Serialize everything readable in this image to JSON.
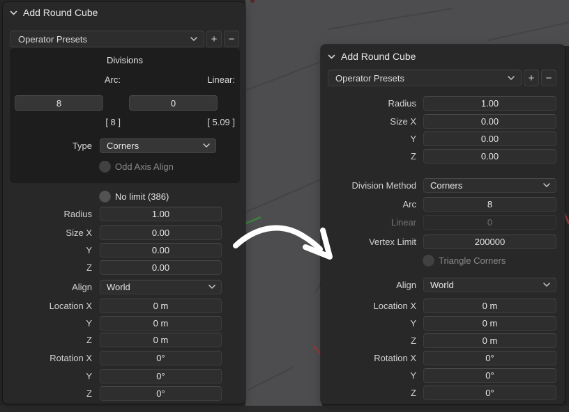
{
  "colors": {
    "panel_bg": "#282828",
    "subpanel_bg": "#1d1d1d",
    "viewport_gray": "#4d4d4f",
    "field_bg": "#2e2e2e",
    "text": "#dedede",
    "disabled_text": "#757575",
    "arrow": "#ffffff",
    "axis_green": "#3f7d3f",
    "axis_red": "#8a3c3c"
  },
  "left_panel": {
    "title": "Add Round Cube",
    "presets": {
      "label": "Operator Presets",
      "add": "+",
      "remove": "−"
    },
    "divisions": {
      "title": "Divisions",
      "arc_label": "Arc:",
      "linear_label": "Linear:",
      "arc_value": "8",
      "linear_value": "0",
      "arc_hint": "[ 8 ]",
      "linear_hint": "[ 5.09 ]",
      "type": {
        "label": "Type",
        "value": "Corners"
      },
      "odd_axis_label": "Odd Axis Align"
    },
    "no_limit_label": "No limit (386)",
    "fields": [
      {
        "label": "Radius",
        "value": "1.00"
      },
      {
        "label": "Size X",
        "value": "0.00"
      },
      {
        "label": "Y",
        "value": "0.00"
      },
      {
        "label": "Z",
        "value": "0.00"
      }
    ],
    "align": {
      "label": "Align",
      "value": "World"
    },
    "location": [
      {
        "label": "Location X",
        "value": "0 m"
      },
      {
        "label": "Y",
        "value": "0 m"
      },
      {
        "label": "Z",
        "value": "0 m"
      }
    ],
    "rotation": [
      {
        "label": "Rotation X",
        "value": "0°"
      },
      {
        "label": "Y",
        "value": "0°"
      },
      {
        "label": "Z",
        "value": "0°"
      }
    ]
  },
  "right_panel": {
    "title": "Add Round Cube",
    "presets": {
      "label": "Operator Presets",
      "add": "+",
      "remove": "−"
    },
    "fields": [
      {
        "label": "Radius",
        "value": "1.00"
      },
      {
        "label": "Size X",
        "value": "0.00"
      },
      {
        "label": "Y",
        "value": "0.00"
      },
      {
        "label": "Z",
        "value": "0.00"
      }
    ],
    "division_method": {
      "label": "Division Method",
      "value": "Corners"
    },
    "arc": {
      "label": "Arc",
      "value": "8"
    },
    "linear": {
      "label": "Linear",
      "value": "0"
    },
    "vertex_limit": {
      "label": "Vertex Limit",
      "value": "200000"
    },
    "triangle_corners_label": "Triangle Corners",
    "align": {
      "label": "Align",
      "value": "World"
    },
    "location": [
      {
        "label": "Location X",
        "value": "0 m"
      },
      {
        "label": "Y",
        "value": "0 m"
      },
      {
        "label": "Z",
        "value": "0 m"
      }
    ],
    "rotation": [
      {
        "label": "Rotation X",
        "value": "0°"
      },
      {
        "label": "Y",
        "value": "0°"
      },
      {
        "label": "Z",
        "value": "0°"
      }
    ]
  }
}
